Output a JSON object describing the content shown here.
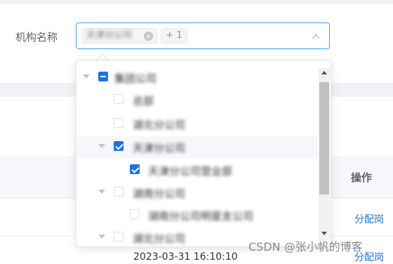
{
  "form": {
    "label": "机构名称",
    "tags": [
      {
        "text": "天津分公司",
        "close_icon": "×"
      },
      {
        "text": "+ 1"
      }
    ],
    "arrow_icon": "chevron-up-icon"
  },
  "tree": {
    "nodes": [
      {
        "label": "集团公司",
        "state": "indeterminate",
        "expandable": true,
        "level": 0
      },
      {
        "label": "总部",
        "state": "unchecked",
        "expandable": false,
        "level": 1
      },
      {
        "label": "湖北分公司",
        "state": "unchecked",
        "expandable": false,
        "level": 1
      },
      {
        "label": "天津分公司",
        "state": "checked",
        "expandable": true,
        "level": 1,
        "highlight": true
      },
      {
        "label": "天津分公司营业部",
        "state": "checked",
        "expandable": false,
        "level": 2
      },
      {
        "label": "湖南分公司",
        "state": "unchecked",
        "expandable": true,
        "level": 1
      },
      {
        "label": "湖南分公司明星支公司",
        "state": "unchecked",
        "expandable": false,
        "level": 2
      },
      {
        "label": "湖北分公司",
        "state": "unchecked",
        "expandable": true,
        "level": 1
      }
    ]
  },
  "table": {
    "header_action": "操作",
    "rows": [
      {
        "action": "分配岗"
      },
      {
        "action": "分配岗",
        "time": "2023-03-31 16:10:10"
      }
    ]
  },
  "watermark": "CSDN @张小帆的博客",
  "colors": {
    "primary": "#1a73e8",
    "focus_border": "#409eff",
    "tag_bg": "#f4f4f5",
    "page_bg": "#f0f2f5"
  }
}
